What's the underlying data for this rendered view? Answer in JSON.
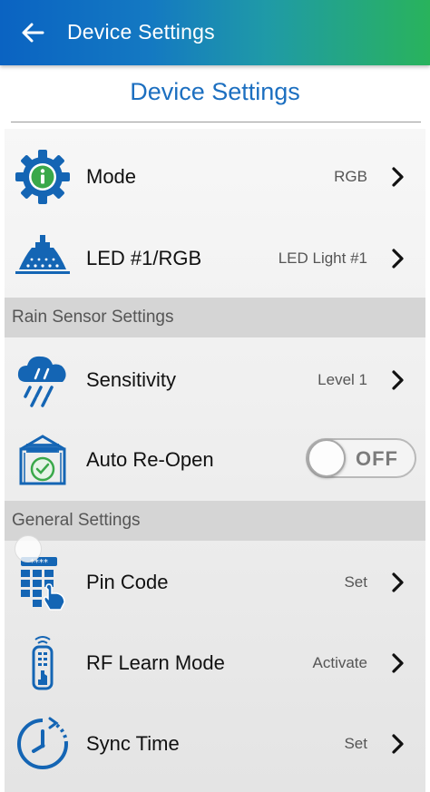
{
  "appbar": {
    "title": "Device Settings"
  },
  "page": {
    "heading": "Device Settings"
  },
  "rows": {
    "mode": {
      "label": "Mode",
      "value": "RGB"
    },
    "led": {
      "label": "LED #1/RGB",
      "value": "LED Light #1"
    },
    "sensitivity": {
      "label": "Sensitivity",
      "value": "Level 1"
    },
    "auto_reopen": {
      "label": "Auto Re-Open",
      "toggle": "OFF"
    },
    "pin_code": {
      "label": "Pin Code",
      "value": "Set"
    },
    "rf_learn": {
      "label": "RF Learn Mode",
      "value": "Activate"
    },
    "sync_time": {
      "label": "Sync Time",
      "value": "Set"
    }
  },
  "sections": {
    "rain": "Rain Sensor Settings",
    "general": "General Settings"
  },
  "colors": {
    "brand_blue": "#1c6fc0",
    "appbar_start": "#0a63c2",
    "appbar_end": "#29b35c",
    "icon_green": "#3aa84a"
  },
  "icons": {
    "back": "arrow-left-icon",
    "mode": "gear-info-icon",
    "led": "ceiling-light-icon",
    "sensitivity": "rain-cloud-icon",
    "auto_reopen": "reopen-clock-icon",
    "pin_code": "keypad-hand-icon",
    "rf_learn": "remote-control-icon",
    "sync_time": "clock-sync-icon",
    "chevron": "chevron-right-icon"
  }
}
